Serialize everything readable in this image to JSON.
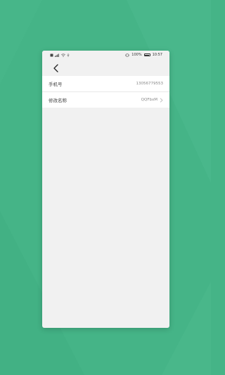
{
  "status_bar": {
    "battery_percent": "100%",
    "time": "10:57",
    "icons": [
      "sim-icon",
      "signal-icon",
      "wifi-icon",
      "usb-icon",
      "vibrate-icon",
      "battery-icon"
    ]
  },
  "nav": {
    "back_icon": "chevron-left-icon"
  },
  "settings": {
    "rows": [
      {
        "label": "手机号",
        "value": "13056779553"
      },
      {
        "label": "修改名称",
        "value": "QQFbxM"
      }
    ]
  },
  "colors": {
    "background": "#45b487",
    "panel": "#f1f1f1",
    "row": "#ffffff"
  }
}
